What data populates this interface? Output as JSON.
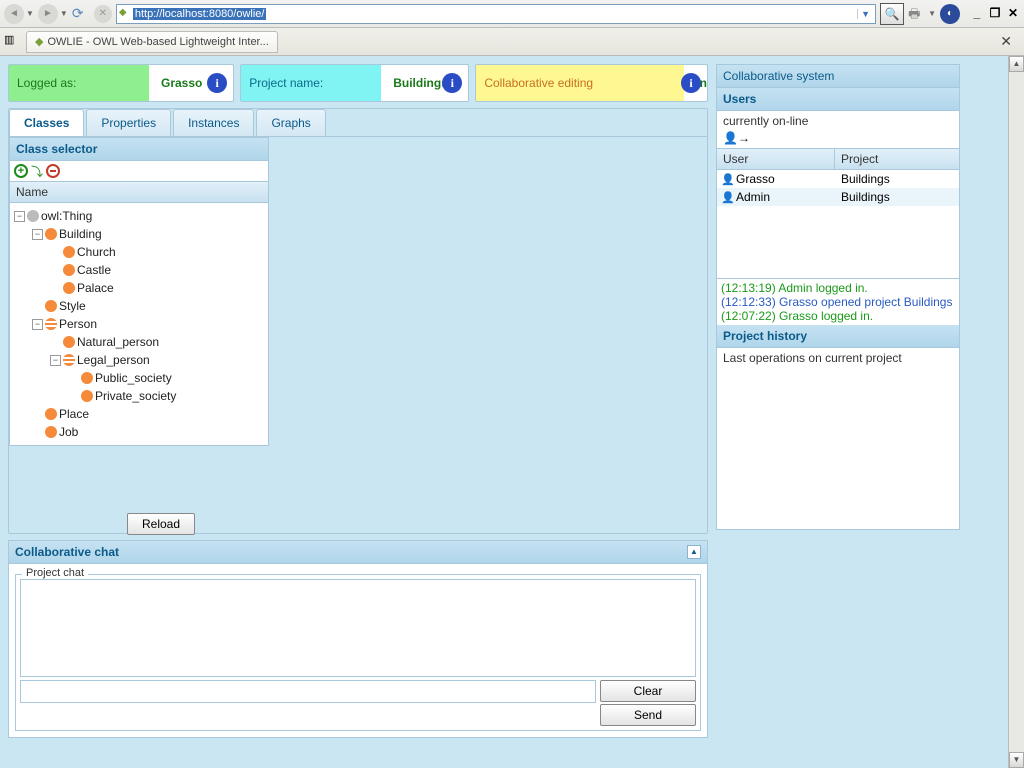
{
  "browser": {
    "url": "http://localhost:8080/owlie/"
  },
  "tab": {
    "title": "OWLIE - OWL Web-based Lightweight Inter..."
  },
  "info": {
    "logged_label": "Logged as:",
    "logged_value": "Grasso",
    "project_label": "Project name:",
    "project_value": "Buildings",
    "collab_label": "Collaborative editing",
    "collab_value": "on"
  },
  "tabs": {
    "classes": "Classes",
    "properties": "Properties",
    "instances": "Instances",
    "graphs": "Graphs"
  },
  "selector": {
    "title": "Class selector",
    "col": "Name",
    "reload": "Reload"
  },
  "tree": {
    "root": "owl:Thing",
    "building": "Building",
    "church": "Church",
    "castle": "Castle",
    "palace": "Palace",
    "style": "Style",
    "person": "Person",
    "natural": "Natural_person",
    "legal": "Legal_person",
    "public": "Public_society",
    "private": "Private_society",
    "place": "Place",
    "job": "Job"
  },
  "chat": {
    "title": "Collaborative chat",
    "legend": "Project chat",
    "clear": "Clear",
    "send": "Send"
  },
  "collab": {
    "title": "Collaborative system",
    "users_hdr": "Users",
    "online": "currently on-line",
    "user_col": "User",
    "proj_col": "Project",
    "rows": [
      {
        "user": "Grasso",
        "project": "Buildings"
      },
      {
        "user": "Admin",
        "project": "Buildings"
      }
    ],
    "log": [
      {
        "cls": "log-green",
        "text": "(12:13:19) Admin logged in."
      },
      {
        "cls": "log-blue",
        "text": "(12:12:33) Grasso opened project Buildings"
      },
      {
        "cls": "log-green",
        "text": "(12:07:22) Grasso logged in."
      }
    ],
    "history_hdr": "Project history",
    "history_text": "Last operations on current project"
  }
}
